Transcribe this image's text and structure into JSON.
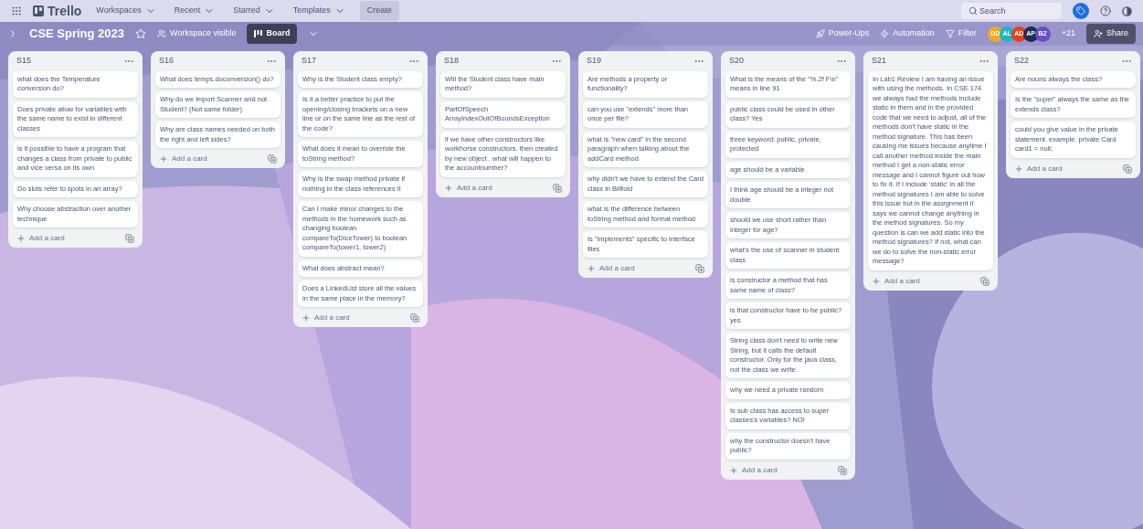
{
  "topbar": {
    "logo": "Trello",
    "menus": [
      "Workspaces",
      "Recent",
      "Starred",
      "Templates"
    ],
    "create": "Create",
    "search": {
      "placeholder": "Search"
    }
  },
  "board": {
    "title": "CSE Spring 2023",
    "visibility": "Workspace visible",
    "view": "Board",
    "actions": [
      "Power-Ups",
      "Automation",
      "Filter"
    ],
    "members": [
      {
        "initials": "DD",
        "color": "#f5a623"
      },
      {
        "initials": "AL",
        "color": "#1fb5c9"
      },
      {
        "initials": "AD",
        "color": "#e4411d"
      },
      {
        "initials": "AP",
        "color": "#1d2e52"
      },
      {
        "initials": "BZ",
        "color": "#6a4fc2"
      }
    ],
    "more_members": "+21",
    "share": "Share"
  },
  "lists": [
    {
      "title": "S15",
      "cards": [
        "what does the Temperature conversion do?",
        "Does private allow for variables with the same name to exist in different classes",
        "is it possible to have a program that changes a class from private to public and vice versa on its own",
        "Do slots refer to spots in an array?",
        "Why choose abstraction over another technique"
      ],
      "add": "Add a card"
    },
    {
      "title": "S16",
      "cards": [
        "What does temps.doconversion() do?",
        "Why do we import Scanner and not Student? (Not same folder)",
        "Why are class names needed on both the right and left sides?"
      ],
      "add": "Add a card"
    },
    {
      "title": "S17",
      "cards": [
        "Why is the Student class empty?",
        "Is it a better practice to put the opening/closing brackets on a new line or on the same line as the rest of the code?",
        "What does it mean to override the toString method?",
        "Why is the swap method private if nothing in the class references it",
        "Can I make minor changes to the methods in the homework such as changing boolean compareTo(DiceTower) to boolean compareTo(tower1, tower2)",
        "What does abstract mean?",
        "Does a LinkedList store all the values in the same place in the memory?"
      ],
      "add": "Add a card"
    },
    {
      "title": "S18",
      "cards": [
        "Will the Student class have main method?",
        "PartOfSpeech ArrayIndexOutOfBoundsException",
        "if we have other constructors like workhorse constructors. then created by new object . what will happen to the accountnumber?"
      ],
      "add": "Add a card"
    },
    {
      "title": "S19",
      "cards": [
        "Are methods a property or functionality?",
        "can you use \"extends\" more than once per file?",
        "what is \"new card\" in the second paragraph when talking about the addCard method",
        "why didn't we have to extend the Card class in Billfold",
        "what is the difference between toString method and format method",
        "Is \"implements\" specific to interface files"
      ],
      "add": "Add a card"
    },
    {
      "title": "S20",
      "cards": [
        "What is the means of the \"%.2f F\\n\" means in line 91",
        "public class could be used in other class? Yes",
        "three keyword: public, private, protected",
        "age should be a variable",
        "I think age should be a integer not double",
        "should we use short rather than integer for age?",
        "what's the use of scanner in student class",
        "is constructor a method that has same name of class?",
        "is that constructor have to be public? yes",
        "String class don't need to write new String, but it calls the default constructor. Only for the java class, not the class we write.",
        "why we need a private random",
        "Is sub class has access to super classes's variables? NO!",
        "why the constructor doesn't have public?"
      ],
      "add": "Add a card"
    },
    {
      "title": "S21",
      "cards": [
        "In Lab1 Review I am having an issue with using the methods. In CSE 174 we always had the methods include static in them and in the provided code that we need to adjust, all of the methods don't have static in the method signature. This has been causing me issues because anytime I call another method inside the main method I get a non-static error message and I cannot figure out how to fix it. If I include 'static' in all the method signatures I am able to solve this issue but in the assignment it says we cannot change anything in the method signatures. So my question is can we add static into the method signatures? If not, what can we do to solve the non-static error message?"
      ],
      "add": "Add a card"
    },
    {
      "title": "S22",
      "cards": [
        "Are nouns always the class?",
        "Is the \"super\" always the same as the extends class?",
        "could you give value in the private statement. example. private Card card1 = null;"
      ],
      "add": "Add a card"
    }
  ]
}
